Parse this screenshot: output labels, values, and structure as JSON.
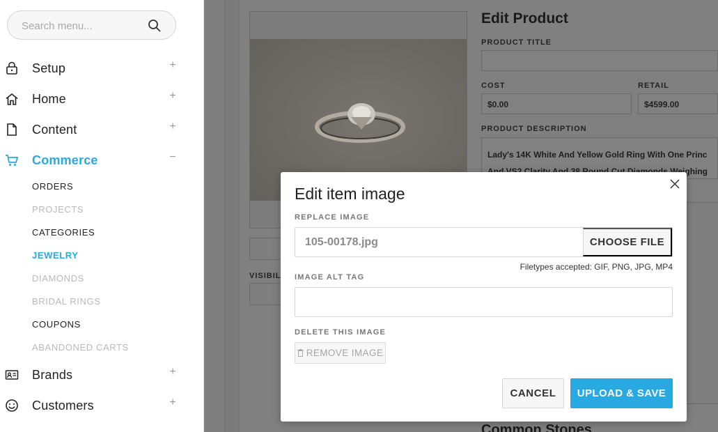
{
  "sidebar": {
    "search_placeholder": "Search menu...",
    "items": [
      {
        "label": "Setup",
        "toggle": "+"
      },
      {
        "label": "Home",
        "toggle": "+"
      },
      {
        "label": "Content",
        "toggle": "+"
      },
      {
        "label": "Commerce",
        "toggle": "−"
      },
      {
        "label": "Brands",
        "toggle": "+"
      },
      {
        "label": "Customers",
        "toggle": "+"
      }
    ],
    "sub_items": [
      "ORDERS",
      "PROJECTS",
      "CATEGORIES",
      "JEWELRY",
      "DIAMONDS",
      "BRIDAL RINGS",
      "COUPONS",
      "ABANDONED CARTS"
    ],
    "accent_color": "#29a9e1"
  },
  "background": {
    "title": "Edit Product",
    "product_title_label": "PRODUCT TITLE",
    "product_title_value": "",
    "cost_label": "COST",
    "cost_value": "$0.00",
    "retail_label": "RETAIL",
    "retail_value": "$4599.00",
    "description_label": "PRODUCT DESCRIPTION",
    "description_line1": "Lady's 14K White And Yellow Gold Ring With One  Princ",
    "description_line2": "And VS2 Clarity And 38 Round Cut Diamonds Weighing",
    "visibility_label": "VISIBIL",
    "section_title": "Common Stones"
  },
  "modal": {
    "title": "Edit item image",
    "replace_label": "REPLACE IMAGE",
    "file_name": "105-00178.jpg",
    "choose_file": "CHOOSE FILE",
    "filetypes": "Filetypes accepted: GIF, PNG, JPG, MP4",
    "alt_label": "IMAGE ALT TAG",
    "alt_value": "",
    "delete_label": "DELETE THIS IMAGE",
    "remove_image": "REMOVE IMAGE",
    "cancel": "CANCEL",
    "upload_save": "UPLOAD & SAVE"
  }
}
